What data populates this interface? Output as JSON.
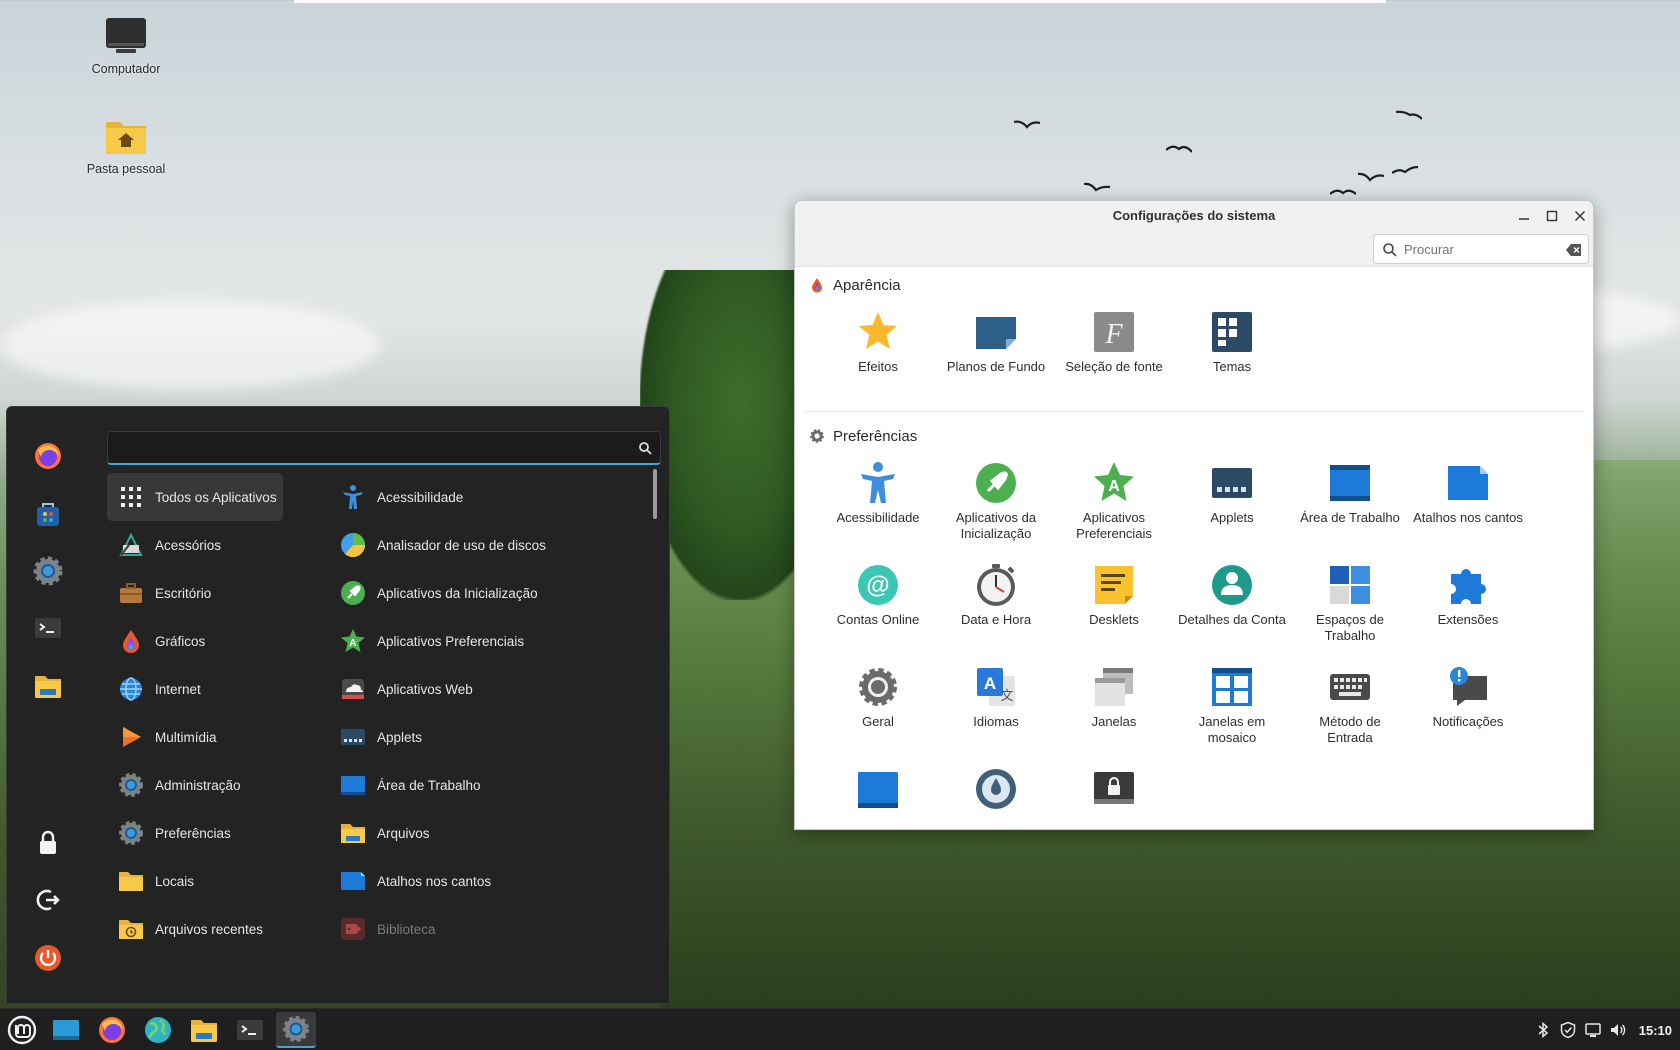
{
  "desktop": {
    "icons": [
      {
        "label": "Computador"
      },
      {
        "label": "Pasta pessoal"
      }
    ]
  },
  "menu": {
    "search": {
      "value": "",
      "placeholder": ""
    },
    "sidebar": [
      "firefox-icon",
      "software-manager-icon",
      "settings-icon",
      "terminal-icon",
      "files-icon",
      "lock-icon",
      "logout-icon",
      "power-icon"
    ],
    "categories": [
      {
        "label": "Todos os Aplicativos",
        "icon": "grid-icon",
        "active": true
      },
      {
        "label": "Acessórios",
        "icon": "accessories-icon"
      },
      {
        "label": "Escritório",
        "icon": "office-icon"
      },
      {
        "label": "Gráficos",
        "icon": "graphics-icon"
      },
      {
        "label": "Internet",
        "icon": "internet-icon"
      },
      {
        "label": "Multimídia",
        "icon": "multimedia-icon"
      },
      {
        "label": "Administração",
        "icon": "administration-icon"
      },
      {
        "label": "Preferências",
        "icon": "preferences-icon"
      },
      {
        "label": "Locais",
        "icon": "places-icon"
      },
      {
        "label": "Arquivos recentes",
        "icon": "recent-files-icon"
      }
    ],
    "apps": [
      {
        "label": "Acessibilidade",
        "icon": "accessibility-icon"
      },
      {
        "label": "Analisador de uso de discos",
        "icon": "disk-usage-icon"
      },
      {
        "label": "Aplicativos da Inicialização",
        "icon": "startup-apps-icon"
      },
      {
        "label": "Aplicativos Preferenciais",
        "icon": "preferred-apps-icon"
      },
      {
        "label": "Aplicativos Web",
        "icon": "web-apps-icon"
      },
      {
        "label": "Applets",
        "icon": "applets-icon"
      },
      {
        "label": "Área de Trabalho",
        "icon": "desktop-icon"
      },
      {
        "label": "Arquivos",
        "icon": "files-icon"
      },
      {
        "label": "Atalhos nos cantos",
        "icon": "hot-corners-icon"
      },
      {
        "label": "Biblioteca",
        "icon": "library-icon",
        "dim": true
      }
    ]
  },
  "settings": {
    "title": "Configurações do sistema",
    "search_placeholder": "Procurar",
    "sections": [
      {
        "title": "Aparência",
        "items": [
          "Efeitos",
          "Planos de Fundo",
          "Seleção de fonte",
          "Temas"
        ]
      },
      {
        "title": "Preferências",
        "items": [
          "Acessibilidade",
          "Aplicativos da Inicialização",
          "Aplicativos Preferenciais",
          "Applets",
          "Área de Trabalho",
          "Atalhos nos cantos",
          "Contas Online",
          "Data e Hora",
          "Desklets",
          "Detalhes da Conta",
          "Espaços de Trabalho",
          "Extensões",
          "Geral",
          "Idiomas",
          "Janelas",
          "Janelas em mosaico",
          "Método de Entrada",
          "Notificações",
          "",
          "",
          ""
        ]
      }
    ]
  },
  "taskbar": {
    "clock": "15:10"
  },
  "colors": {
    "accent": "#4aa3d8",
    "menu_bg": "#232323",
    "taskbar_bg": "#1f1f1f"
  }
}
